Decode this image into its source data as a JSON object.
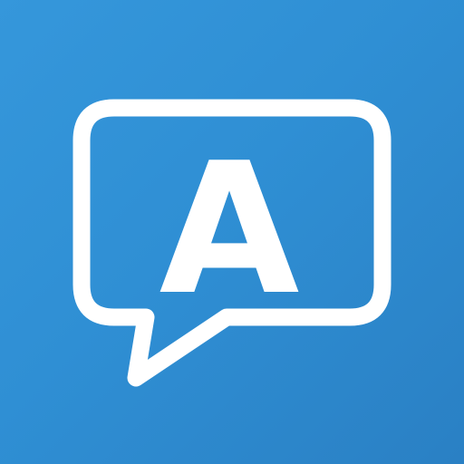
{
  "app_icon": {
    "icon": "speech-bubble-icon",
    "letter": "A",
    "colors": {
      "background_start": "#3597db",
      "background_end": "#2a80c4",
      "foreground": "#ffffff"
    }
  }
}
